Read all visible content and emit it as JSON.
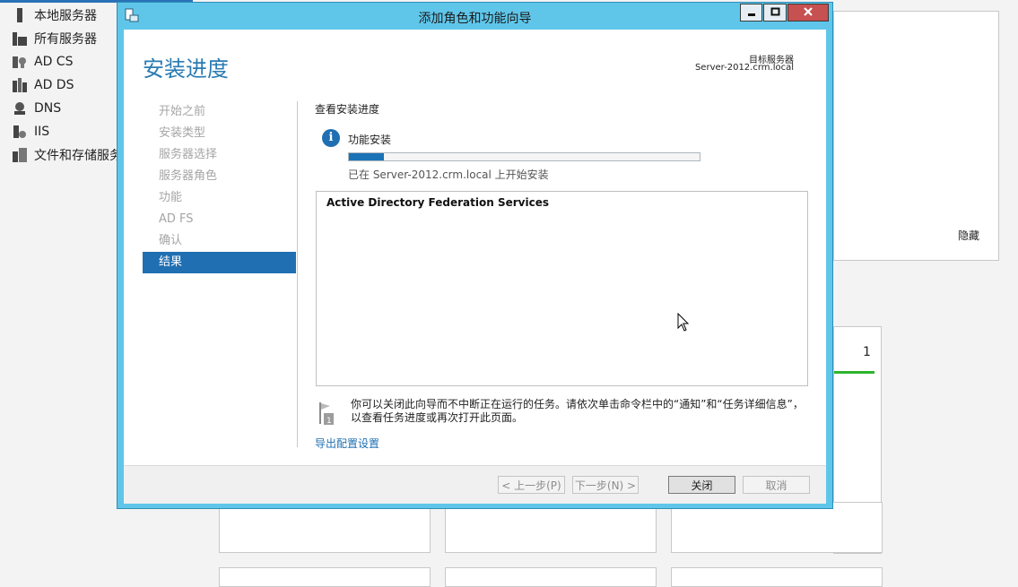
{
  "background": {
    "sidebar": [
      {
        "label": "本地服务器",
        "icon": "server-icon"
      },
      {
        "label": "所有服务器",
        "icon": "servers-icon"
      },
      {
        "label": "AD CS",
        "icon": "certificate-icon"
      },
      {
        "label": "AD DS",
        "icon": "directory-icon"
      },
      {
        "label": "DNS",
        "icon": "dns-icon"
      },
      {
        "label": "IIS",
        "icon": "iis-icon"
      },
      {
        "label": "文件和存储服务",
        "icon": "storage-icon"
      }
    ],
    "hide_label": "隐藏",
    "tile_count": "1"
  },
  "window": {
    "title": "添加角色和功能向导",
    "controls": {
      "minimize": "minimize-icon",
      "maximize": "maximize-icon",
      "close": "close-icon"
    }
  },
  "wizard": {
    "heading": "安装进度",
    "target_label": "目标服务器",
    "target_value": "Server-2012.crm.local",
    "nav": [
      {
        "label": "开始之前",
        "active": false
      },
      {
        "label": "安装类型",
        "active": false
      },
      {
        "label": "服务器选择",
        "active": false
      },
      {
        "label": "服务器角色",
        "active": false
      },
      {
        "label": "功能",
        "active": false
      },
      {
        "label": "AD FS",
        "active": false
      },
      {
        "label": "确认",
        "active": false
      },
      {
        "label": "结果",
        "active": true
      }
    ],
    "section_label": "查看安装进度",
    "info_icon_glyph": "i",
    "info_title": "功能安装",
    "progress_fraction": 0.1,
    "progress_text": "已在 Server-2012.crm.local 上开始安装",
    "results": [
      "Active Directory Federation Services"
    ],
    "note": "你可以关闭此向导而不中断正在运行的任务。请依次单击命令栏中的“通知”和“任务详细信息”，以查看任务进度或再次打开此页面。",
    "export_link": "导出配置设置",
    "buttons": {
      "prev": "< 上一步(P)",
      "next": "下一步(N) >",
      "close": "关闭",
      "cancel": "取消"
    }
  },
  "colors": {
    "accent": "#1f6fb2",
    "title_bar": "#5fc6ea",
    "close_button": "#c75050"
  }
}
